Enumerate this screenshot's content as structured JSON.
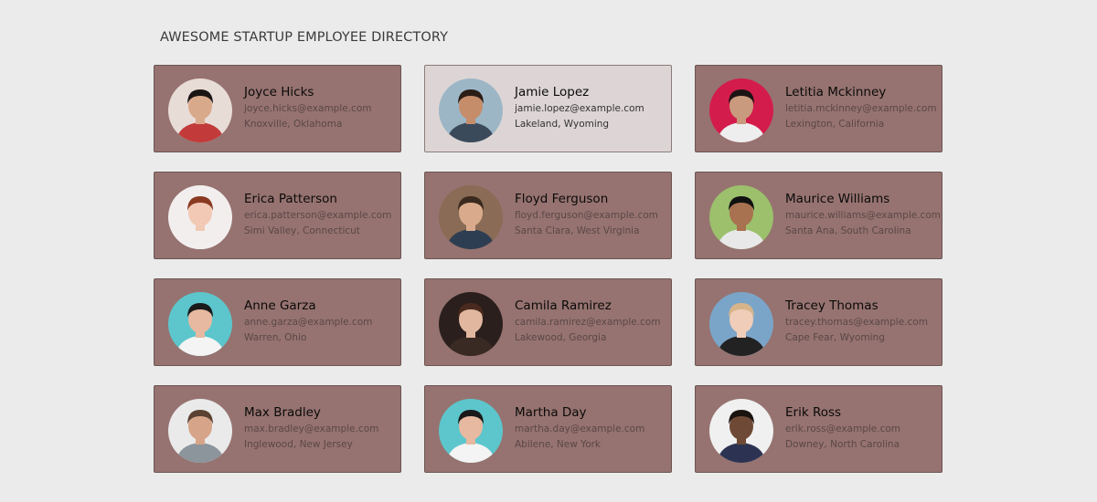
{
  "header": {
    "title": "AWESOME STARTUP EMPLOYEE DIRECTORY"
  },
  "employees": [
    {
      "name": "Joyce Hicks",
      "email": "joyce.hicks@example.com",
      "location": "Knoxville, Oklahoma",
      "bg": "#e8dcd6",
      "skin": "#d9a98c",
      "hair": "#1a1414",
      "shirt": "#c23a3a",
      "selected": false
    },
    {
      "name": "Jamie Lopez",
      "email": "jamie.lopez@example.com",
      "location": "Lakeland, Wyoming",
      "bg": "#9cb6c6",
      "skin": "#c68d6b",
      "hair": "#2a1d16",
      "shirt": "#3a4a5a",
      "selected": true
    },
    {
      "name": "Letitia Mckinney",
      "email": "letitia.mckinney@example.com",
      "location": "Lexington, California",
      "bg": "#d41c4c",
      "skin": "#c99a7d",
      "hair": "#1c1414",
      "shirt": "#eeeeee",
      "selected": false
    },
    {
      "name": "Erica Patterson",
      "email": "erica.patterson@example.com",
      "location": "Simi Valley, Connecticut",
      "bg": "#f2eeee",
      "skin": "#f1c9b5",
      "hair": "#8b3a22",
      "shirt": "#f2eeee",
      "selected": false
    },
    {
      "name": "Floyd Ferguson",
      "email": "floyd.ferguson@example.com",
      "location": "Santa Clara, West Virginia",
      "bg": "#8a6b55",
      "skin": "#d9ab8c",
      "hair": "#3a2a1e",
      "shirt": "#2e3e52",
      "selected": false
    },
    {
      "name": "Maurice Williams",
      "email": "maurice.williams@example.com",
      "location": "Santa Ana, South Carolina",
      "bg": "#9cc06c",
      "skin": "#a8714f",
      "hair": "#111111",
      "shirt": "#e8e8e8",
      "selected": false
    },
    {
      "name": "Anne Garza",
      "email": "anne.garza@example.com",
      "location": "Warren, Ohio",
      "bg": "#5cc6cc",
      "skin": "#e6b9a0",
      "hair": "#1a1a1a",
      "shirt": "#f4f4f4",
      "selected": false
    },
    {
      "name": "Camila Ramirez",
      "email": "camila.ramirez@example.com",
      "location": "Lakewood, Georgia",
      "bg": "#2a1f1c",
      "skin": "#e2b7a0",
      "hair": "#4a2a1e",
      "shirt": "#3a2a24",
      "selected": false
    },
    {
      "name": "Tracey Thomas",
      "email": "tracey.thomas@example.com",
      "location": "Cape Fear, Wyoming",
      "bg": "#7aa5c9",
      "skin": "#f0cdb8",
      "hair": "#d8b48a",
      "shirt": "#222222",
      "selected": false
    },
    {
      "name": "Max Bradley",
      "email": "max.bradley@example.com",
      "location": "Inglewood, New Jersey",
      "bg": "#eaeaea",
      "skin": "#d6a488",
      "hair": "#5a4232",
      "shirt": "#8c949c",
      "selected": false
    },
    {
      "name": "Martha Day",
      "email": "martha.day@example.com",
      "location": "Abilene, New York",
      "bg": "#5cc6cc",
      "skin": "#e6b9a0",
      "hair": "#1a1a1a",
      "shirt": "#f4f4f4",
      "selected": false
    },
    {
      "name": "Erik Ross",
      "email": "erik.ross@example.com",
      "location": "Downey, North Carolina",
      "bg": "#f0f0f0",
      "skin": "#6e4a36",
      "hair": "#1a1410",
      "shirt": "#2c3352",
      "selected": false
    }
  ]
}
